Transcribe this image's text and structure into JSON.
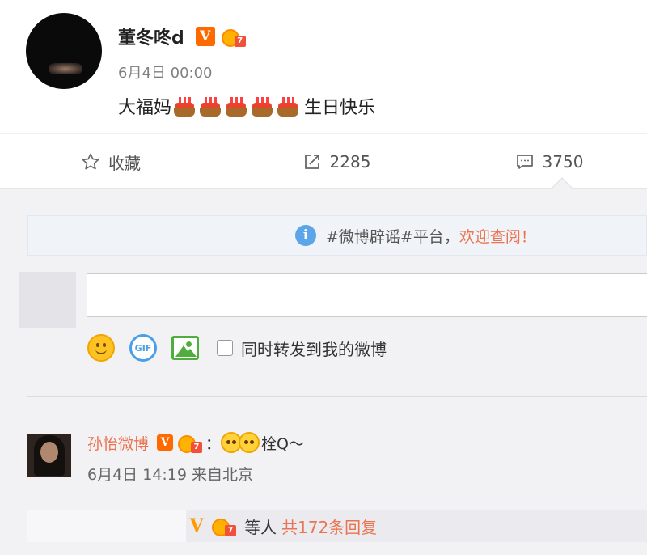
{
  "post": {
    "author": "董冬咚d",
    "verified_badge": "V",
    "level_badge": "7",
    "time": "6月4日 00:00",
    "text_before": "大福妈",
    "cake_icons": [
      "cake-emoji",
      "cake-emoji",
      "cake-emoji",
      "cake-emoji",
      "cake-emoji"
    ],
    "text_after": "生日快乐"
  },
  "actions": {
    "favorite_label": "收藏",
    "repost_count": "2285",
    "comment_count": "3750"
  },
  "notice": {
    "info_symbol": "i",
    "text": "#微博辟谣#平台，",
    "link": "欢迎查阅！"
  },
  "composer": {
    "input_value": "",
    "tools": [
      "smile-icon",
      "gif-icon",
      "image-icon"
    ],
    "gif_label": "GIF",
    "repost_option_label": "同时转发到我的微博"
  },
  "comment": {
    "author": "孙怡微博",
    "verified_badge": "V",
    "level_badge": "7",
    "text": "：",
    "emoji_icons": [
      "blush-emoji",
      "blush-emoji"
    ],
    "text_after": "栓Q～",
    "time": "6月4日 14:19",
    "source": "来自北京",
    "reply_verified_badge": "V",
    "reply_suffix": "等人",
    "reply_count": "共172条回复"
  },
  "colors": {
    "accent": "#eb7350",
    "verified": "#ff6a00",
    "info": "#5ba5e8",
    "panel": "#f2f2f5"
  }
}
